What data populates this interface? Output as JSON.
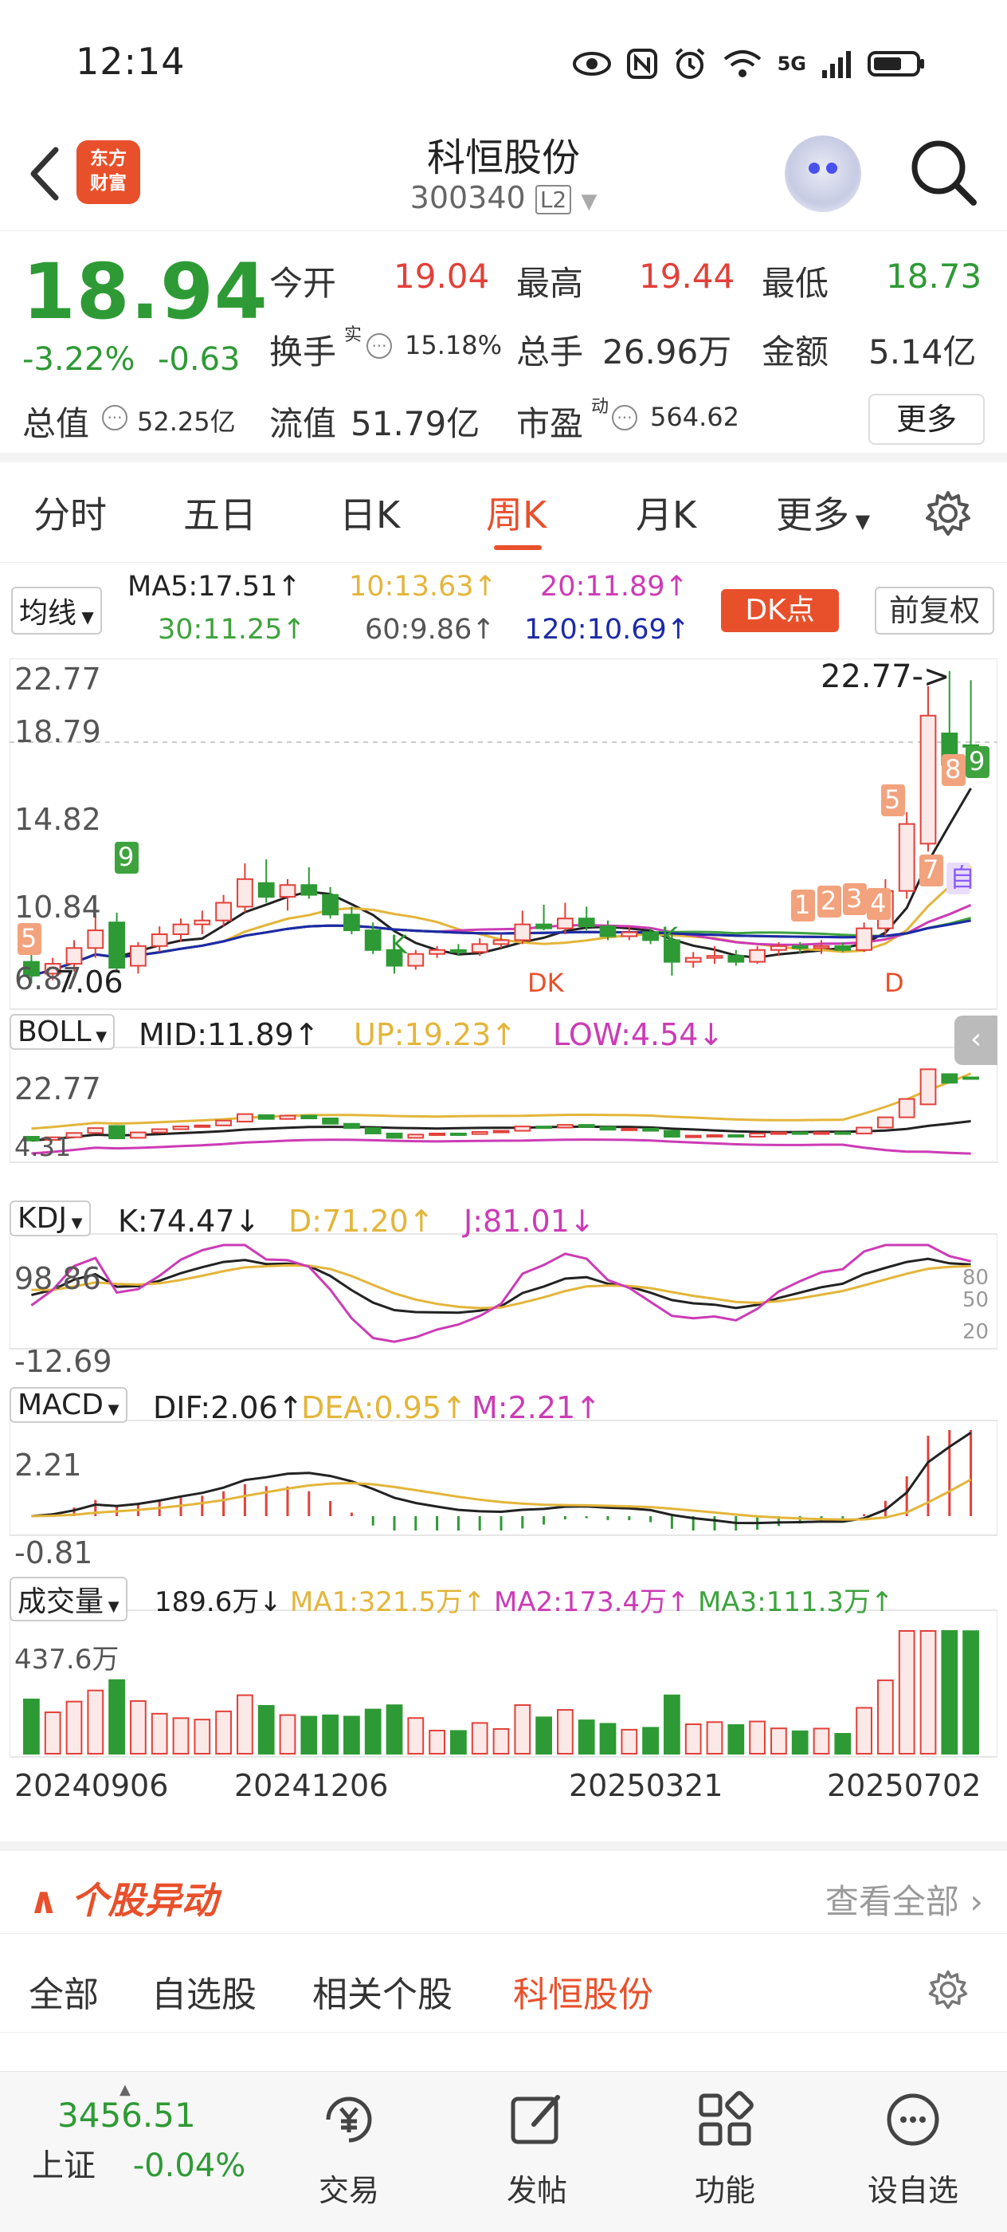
{
  "status_bar": {
    "time": "12:14",
    "network": "5G",
    "signal_hint": "6"
  },
  "header": {
    "logo_text_1": "东方",
    "logo_text_2": "财富",
    "stock_name": "科恒股份",
    "stock_code": "300340",
    "level_badge": "L2"
  },
  "quote": {
    "price": "18.94",
    "change_pct": "-3.22%",
    "change": "-0.63",
    "open_label": "今开",
    "open": "19.04",
    "high_label": "最高",
    "high": "19.44",
    "low_label": "最低",
    "low": "18.73",
    "turnover_label": "换手",
    "turnover_sup": "实",
    "turnover": "15.18%",
    "volume_label": "总手",
    "volume": "26.96万",
    "amount_label": "金额",
    "amount": "5.14亿",
    "total_mv_label": "总值",
    "total_mv": "52.25亿",
    "float_mv_label": "流值",
    "float_mv": "51.79亿",
    "pe_label": "市盈",
    "pe_sup": "动",
    "pe": "564.62",
    "more_label": "更多",
    "colors": {
      "up": "#e2403a",
      "down": "#2e9a35",
      "accent": "#e8502b"
    }
  },
  "tabs": [
    "分时",
    "五日",
    "日K",
    "周K",
    "月K",
    "更多"
  ],
  "active_tab": "周K",
  "ma_row": {
    "selector": "均线",
    "ma5": "MA5:17.51↑",
    "ma10": "10:13.63↑",
    "ma20": "20:11.89↑",
    "ma30": "30:11.25↑",
    "ma60": "60:9.86↑",
    "ma120": "120:10.69↑",
    "dk_button": "DK点",
    "fuquan": "前复权"
  },
  "chart_data": [
    {
      "type": "candlestick",
      "title": "周K",
      "ylabels": [
        "22.77",
        "18.79",
        "14.82",
        "10.84",
        "6.87"
      ],
      "ylim": [
        6.0,
        23.0
      ],
      "max_annotation": "22.77->",
      "min_annotation": "7.06",
      "markers": [
        "K",
        "K",
        "DK",
        "D",
        "1",
        "2",
        "3",
        "4",
        "5",
        "5",
        "7",
        "8",
        "9",
        "9",
        "自"
      ],
      "candles": [
        {
          "o": 8.0,
          "h": 8.6,
          "l": 6.9,
          "c": 7.3
        },
        {
          "o": 7.4,
          "h": 8.2,
          "l": 7.06,
          "c": 7.9
        },
        {
          "o": 7.9,
          "h": 9.1,
          "l": 7.5,
          "c": 8.7
        },
        {
          "o": 8.7,
          "h": 10.4,
          "l": 8.2,
          "c": 9.6
        },
        {
          "o": 10.0,
          "h": 10.5,
          "l": 7.5,
          "c": 7.7
        },
        {
          "o": 7.8,
          "h": 9.0,
          "l": 7.4,
          "c": 8.8
        },
        {
          "o": 8.8,
          "h": 9.8,
          "l": 8.5,
          "c": 9.4
        },
        {
          "o": 9.4,
          "h": 10.2,
          "l": 9.0,
          "c": 9.9
        },
        {
          "o": 9.9,
          "h": 10.6,
          "l": 9.4,
          "c": 10.1
        },
        {
          "o": 10.1,
          "h": 11.4,
          "l": 9.8,
          "c": 11.0
        },
        {
          "o": 10.8,
          "h": 13.0,
          "l": 10.5,
          "c": 12.2
        },
        {
          "o": 12.0,
          "h": 13.2,
          "l": 11.0,
          "c": 11.3
        },
        {
          "o": 11.3,
          "h": 12.2,
          "l": 10.6,
          "c": 11.9
        },
        {
          "o": 11.9,
          "h": 12.8,
          "l": 11.2,
          "c": 11.4
        },
        {
          "o": 11.4,
          "h": 11.8,
          "l": 10.2,
          "c": 10.4
        },
        {
          "o": 10.4,
          "h": 10.8,
          "l": 9.4,
          "c": 9.6
        },
        {
          "o": 9.6,
          "h": 10.0,
          "l": 8.4,
          "c": 8.6
        },
        {
          "o": 8.6,
          "h": 9.0,
          "l": 7.4,
          "c": 7.8
        },
        {
          "o": 7.8,
          "h": 8.6,
          "l": 7.6,
          "c": 8.4
        },
        {
          "o": 8.4,
          "h": 8.8,
          "l": 8.2,
          "c": 8.6
        },
        {
          "o": 8.6,
          "h": 8.9,
          "l": 8.3,
          "c": 8.5
        },
        {
          "o": 8.5,
          "h": 9.2,
          "l": 8.3,
          "c": 8.9
        },
        {
          "o": 8.9,
          "h": 9.4,
          "l": 8.7,
          "c": 9.1
        },
        {
          "o": 9.1,
          "h": 10.6,
          "l": 8.9,
          "c": 9.9
        },
        {
          "o": 9.9,
          "h": 10.9,
          "l": 9.6,
          "c": 9.7
        },
        {
          "o": 9.7,
          "h": 11.0,
          "l": 9.4,
          "c": 10.2
        },
        {
          "o": 10.2,
          "h": 10.8,
          "l": 9.6,
          "c": 9.8
        },
        {
          "o": 9.8,
          "h": 10.1,
          "l": 9.1,
          "c": 9.3
        },
        {
          "o": 9.3,
          "h": 9.8,
          "l": 9.1,
          "c": 9.5
        },
        {
          "o": 9.5,
          "h": 9.7,
          "l": 8.9,
          "c": 9.1
        },
        {
          "o": 9.1,
          "h": 9.4,
          "l": 7.3,
          "c": 8.0
        },
        {
          "o": 8.0,
          "h": 8.5,
          "l": 7.7,
          "c": 8.2
        },
        {
          "o": 8.2,
          "h": 8.8,
          "l": 7.9,
          "c": 8.3
        },
        {
          "o": 8.3,
          "h": 8.6,
          "l": 7.8,
          "c": 8.0
        },
        {
          "o": 8.0,
          "h": 8.8,
          "l": 7.9,
          "c": 8.6
        },
        {
          "o": 8.6,
          "h": 9.0,
          "l": 8.3,
          "c": 8.8
        },
        {
          "o": 8.8,
          "h": 9.0,
          "l": 8.4,
          "c": 8.7
        },
        {
          "o": 8.7,
          "h": 9.1,
          "l": 8.4,
          "c": 8.8
        },
        {
          "o": 8.8,
          "h": 9.0,
          "l": 8.5,
          "c": 8.6
        },
        {
          "o": 8.6,
          "h": 10.0,
          "l": 8.5,
          "c": 9.7
        },
        {
          "o": 9.7,
          "h": 12.2,
          "l": 9.3,
          "c": 11.6
        },
        {
          "o": 11.6,
          "h": 15.6,
          "l": 11.2,
          "c": 15.0
        },
        {
          "o": 14.0,
          "h": 22.0,
          "l": 13.6,
          "c": 20.5
        },
        {
          "o": 19.6,
          "h": 22.77,
          "l": 17.4,
          "c": 18.0
        },
        {
          "o": 19.0,
          "h": 22.3,
          "l": 18.2,
          "c": 18.94
        }
      ]
    },
    {
      "type": "line",
      "title": "BOLL",
      "series": [
        {
          "name": "MID:11.89↑"
        },
        {
          "name": "UP:19.23↑"
        },
        {
          "name": "LOW:4.54↓"
        }
      ],
      "ylabels": [
        "22.77",
        "4.31"
      ]
    },
    {
      "type": "line",
      "title": "KDJ",
      "series": [
        {
          "name": "K:74.47↓"
        },
        {
          "name": "D:71.20↑"
        },
        {
          "name": "J:81.01↓"
        }
      ],
      "ylabels": [
        "98.86",
        "-12.69"
      ],
      "right_labels": [
        "80",
        "50",
        "20"
      ]
    },
    {
      "type": "line",
      "title": "MACD",
      "series": [
        {
          "name": "DIF:2.06↑"
        },
        {
          "name": "DEA:0.95↑"
        },
        {
          "name": "M:2.21↑"
        }
      ],
      "ylabels": [
        "2.21",
        "-0.81"
      ]
    },
    {
      "type": "bar",
      "title": "成交量",
      "series": [
        {
          "name": "189.6万↓"
        },
        {
          "name": "MA1:321.5万↑"
        },
        {
          "name": "MA2:173.4万↑"
        },
        {
          "name": "MA3:111.3万↑"
        }
      ],
      "ylabels": [
        "437.6万"
      ],
      "dates": [
        "20240906",
        "20241206",
        "20250321",
        "20250702"
      ]
    }
  ],
  "yidong": {
    "title": "个股异动",
    "view_all": "查看全部"
  },
  "subtabs": [
    "全部",
    "自选股",
    "相关个股",
    "科恒股份"
  ],
  "active_subtab": "科恒股份",
  "bottom_nav": {
    "index_value": "3456.51",
    "index_name": "上证",
    "index_change": "-0.04%",
    "items": [
      "交易",
      "发帖",
      "功能",
      "设自选"
    ]
  }
}
